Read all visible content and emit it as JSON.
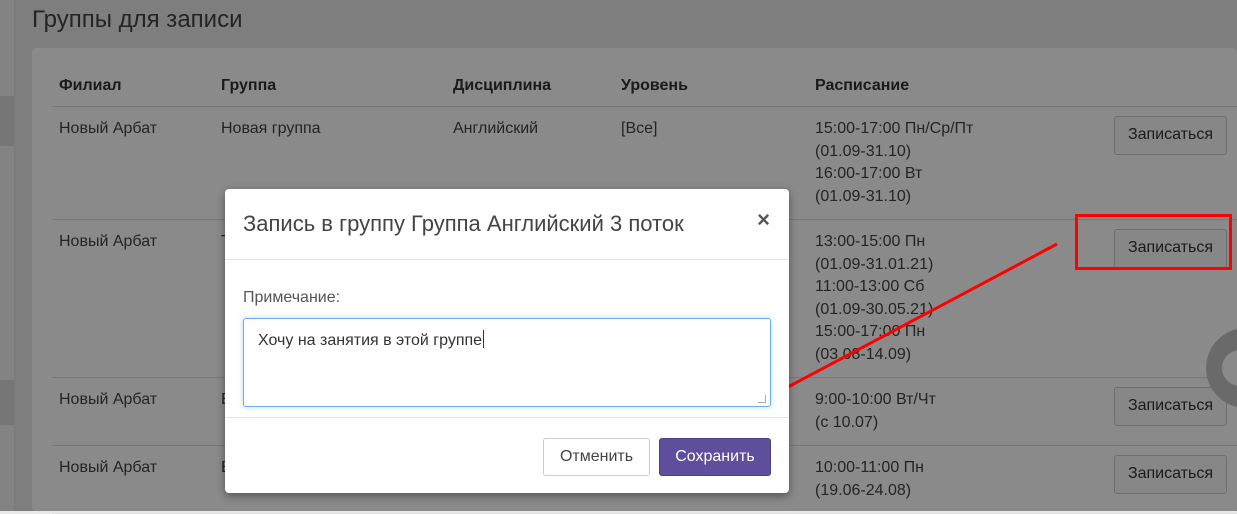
{
  "page": {
    "title": "Группы для записи"
  },
  "table": {
    "headers": [
      "Филиал",
      "Группа",
      "Дисциплина",
      "Уровень",
      "Расписание",
      ""
    ],
    "rows": [
      {
        "branch": "Новый Арбат",
        "group": "Новая группа",
        "discipline": "Английский",
        "level": "[Все]",
        "schedule": [
          "15:00-17:00 Пн/Ср/Пт",
          "(01.09-31.10)",
          "16:00-17:00 Вт",
          "(01.09-31.10)"
        ],
        "action": "Записаться"
      },
      {
        "branch": "Новый Арбат",
        "group": "Т",
        "discipline": "",
        "level": "",
        "schedule": [
          "13:00-15:00 Пн",
          "(01.09-31.01.21)",
          "11:00-13:00 Сб",
          "(01.09-30.05.21)",
          "15:00-17:00 Пн",
          "(03.08-14.09)"
        ],
        "action": "Записаться"
      },
      {
        "branch": "Новый Арбат",
        "group": "Е",
        "discipline": "",
        "level": "",
        "schedule": [
          "9:00-10:00 Вт/Чт",
          "(с 10.07)"
        ],
        "action": "Записаться"
      },
      {
        "branch": "Новый Арбат",
        "group": "Е",
        "discipline": "",
        "level": "",
        "schedule": [
          "10:00-11:00 Пн",
          "(19.06-24.08)"
        ],
        "action": "Записаться"
      }
    ]
  },
  "modal": {
    "title": "Запись в группу Группа Английский 3 поток",
    "close_icon": "×",
    "note_label": "Примечание:",
    "note_value": "Хочу на занятия в этой группе",
    "cancel_label": "Отменить",
    "save_label": "Сохранить"
  },
  "colors": {
    "primary": "#5f4e9c",
    "highlight": "#ff0000",
    "focus_border": "#66afe9"
  }
}
